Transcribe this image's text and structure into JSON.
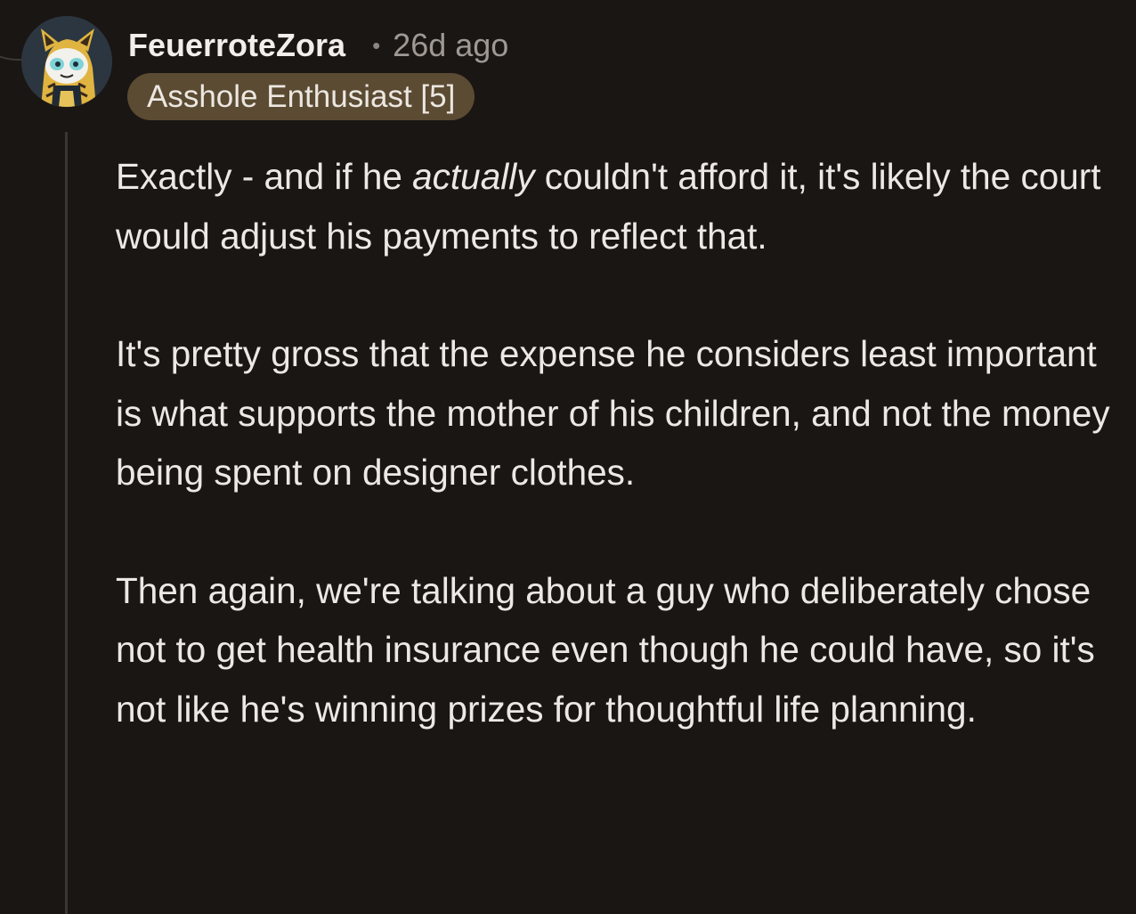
{
  "comment": {
    "author": "FeuerroteZora",
    "separator": "•",
    "age": "26d ago",
    "flair": "Asshole Enthusiast [5]",
    "avatar_icon": "cartoon-avatar-icon",
    "paragraphs": [
      {
        "before": "Exactly - and if he ",
        "emphasis": "actually",
        "after": " couldn't afford it, it's likely the court would adjust his payments to reflect that."
      },
      {
        "text": "It's pretty gross that the expense he considers least important is what supports the mother of his children, and not the money being spent on designer clothes."
      },
      {
        "text": "Then again, we're talking about a guy who deliberately chose not to get health insurance even though he could have, so it's not like he's winning prizes for thoughtful life planning."
      }
    ]
  },
  "colors": {
    "background": "#1a1614",
    "flair_background": "#5b4b33",
    "thread_line": "#3a3633"
  }
}
